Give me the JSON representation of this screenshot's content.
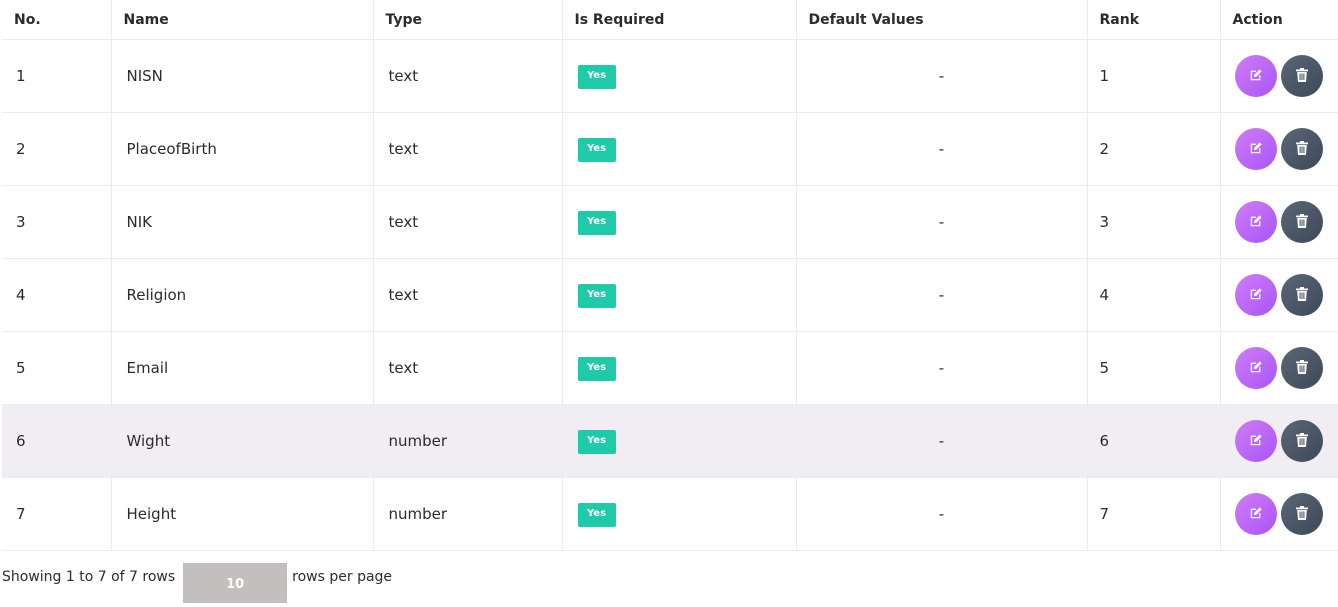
{
  "table": {
    "headers": {
      "no": "No.",
      "name": "Name",
      "type": "Type",
      "required": "Is Required",
      "default": "Default Values",
      "rank": "Rank",
      "action": "Action"
    },
    "rows": [
      {
        "no": "1",
        "name": "NISN",
        "type": "text",
        "required": "Yes",
        "default": "-",
        "rank": "1"
      },
      {
        "no": "2",
        "name": "PlaceofBirth",
        "type": "text",
        "required": "Yes",
        "default": "-",
        "rank": "2"
      },
      {
        "no": "3",
        "name": "NIK",
        "type": "text",
        "required": "Yes",
        "default": "-",
        "rank": "3"
      },
      {
        "no": "4",
        "name": "Religion",
        "type": "text",
        "required": "Yes",
        "default": "-",
        "rank": "4"
      },
      {
        "no": "5",
        "name": "Email",
        "type": "text",
        "required": "Yes",
        "default": "-",
        "rank": "5"
      },
      {
        "no": "6",
        "name": "Wight",
        "type": "number",
        "required": "Yes",
        "default": "-",
        "rank": "6"
      },
      {
        "no": "7",
        "name": "Height",
        "type": "number",
        "required": "Yes",
        "default": "-",
        "rank": "7"
      }
    ],
    "highlighted_row": 6,
    "action_icons": [
      "edit-icon",
      "trash-icon"
    ]
  },
  "pagination": {
    "showing_text": "Showing 1 to 7 of 7 rows",
    "page_size": "10",
    "rows_per_page_text": "rows per page"
  },
  "colors": {
    "badge": "#1fcaa8",
    "edit_button": "#b865f6",
    "delete_button": "#4a5566",
    "highlight_row": "#f1eef3",
    "page_size_box": "#c3bfbf"
  }
}
